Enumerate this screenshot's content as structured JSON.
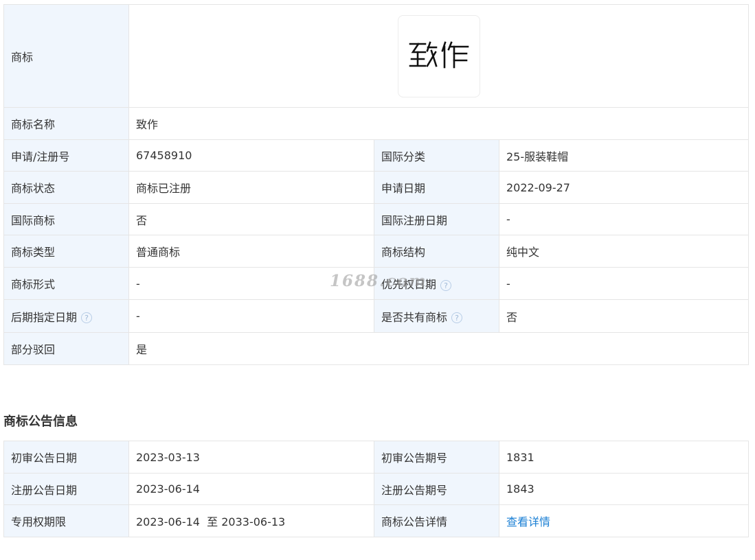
{
  "info_table": {
    "logo": {
      "label": "商标",
      "text": "致作"
    },
    "name": {
      "label": "商标名称",
      "value": "致作"
    },
    "rows": [
      {
        "l1": "申请/注册号",
        "v1": "67458910",
        "l2": "国际分类",
        "v2": "25-服装鞋帽"
      },
      {
        "l1": "商标状态",
        "v1": "商标已注册",
        "l2": "申请日期",
        "v2": "2022-09-27"
      },
      {
        "l1": "国际商标",
        "v1": "否",
        "l2": "国际注册日期",
        "v2": "-"
      },
      {
        "l1": "商标类型",
        "v1": "普通商标",
        "l2": "商标结构",
        "v2": "纯中文"
      },
      {
        "l1": "商标形式",
        "v1": "-",
        "l2": "优先权日期",
        "v2": "-"
      },
      {
        "l1": "后期指定日期",
        "v1": "-",
        "l2": "是否共有商标",
        "v2": "否"
      }
    ],
    "partial": {
      "label": "部分驳回",
      "value": "是"
    },
    "help_glyph": "?"
  },
  "watermark": "1688.com",
  "announcement": {
    "title": "商标公告信息",
    "rows": [
      {
        "l1": "初审公告日期",
        "v1": "2023-03-13",
        "l2": "初审公告期号",
        "v2": "1831"
      },
      {
        "l1": "注册公告日期",
        "v1": "2023-06-14",
        "l2": "注册公告期号",
        "v2": "1843"
      },
      {
        "l1": "专用权期限",
        "v1": "2023-06-14  至 2033-06-13",
        "l2": "商标公告详情",
        "v2": "查看详情"
      }
    ]
  },
  "colors": {
    "label_bg": "#f0f6fd",
    "border": "#e5e5e5",
    "link": "#1a7fd4",
    "text": "#333333"
  }
}
